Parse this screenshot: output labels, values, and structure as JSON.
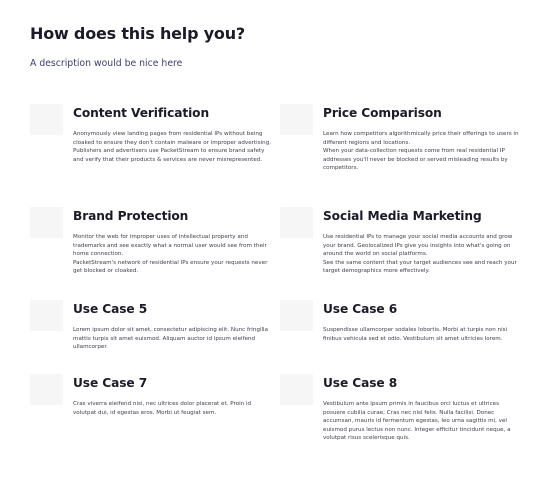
{
  "header": {
    "title": "How does this help you?",
    "subtitle": "A description would be nice here"
  },
  "cards": [
    {
      "title": "Content Verification",
      "paragraphs": [
        "Anonymously view landing pages from residential IPs without being cloaked to ensure they don't contain malware or improper advertising.",
        "Publishers and advertisers use PacketStream to ensure brand safety and verify that their products & services are never misrepresented."
      ]
    },
    {
      "title": "Price Comparison",
      "paragraphs": [
        "Learn how competitors algorithmically price their offerings to users in different regions and locations.",
        "When your data-collection requests come from real residential IP addresses you'll never be blocked or served misleading results by competitors."
      ]
    },
    {
      "title": "Brand Protection",
      "paragraphs": [
        "Monitor the web for improper uses of intellectual property and trademarks and see exactly what a normal user would see from their home connection.",
        "PacketStream's network of residential IPs ensure your requests never get blocked or cloaked."
      ]
    },
    {
      "title": "Social Media Marketing",
      "paragraphs": [
        "Use residential IPs to manage your social media accounts and grow your brand. Geolocalized IPs give you insights into what's going on around the world on social platforms.",
        "See the same content that your target audiences see and reach your target demographics more effectively."
      ]
    },
    {
      "title": "Use Case 5",
      "paragraphs": [
        "Lorem ipsum dolor sit amet, consectetur adipiscing elit. Nunc fringilla mattis turpis sit amet euismod. Aliquam auctor id ipsum eleifend ullamcorper."
      ]
    },
    {
      "title": "Use Case 6",
      "paragraphs": [
        "Suspendisse ullamcorper sodales lobortis. Morbi at turpis non nisi finibus vehicula sed et odio. Vestibulum sit amet ultricies lorem."
      ]
    },
    {
      "title": "Use Case 7",
      "paragraphs": [
        "Cras viverra eleifend nisi, nec ultrices dolor placerat et. Proin id volutpat dui, id egestas eros. Morbi ut feugiat sem."
      ]
    },
    {
      "title": "Use Case 8",
      "paragraphs": [
        "Vestibulum ante ipsum primis in faucibus orci luctus et ultrices posuere cubilia curae; Cras nec nisl felis. Nulla facilisi. Donec accumsan, mauris id fermentum egestas, leo urna sagittis mi, vel euismod purus lectus non nunc. Integer efficitur tincidunt neque, a volutpat risus scelerisque quis."
      ]
    }
  ]
}
